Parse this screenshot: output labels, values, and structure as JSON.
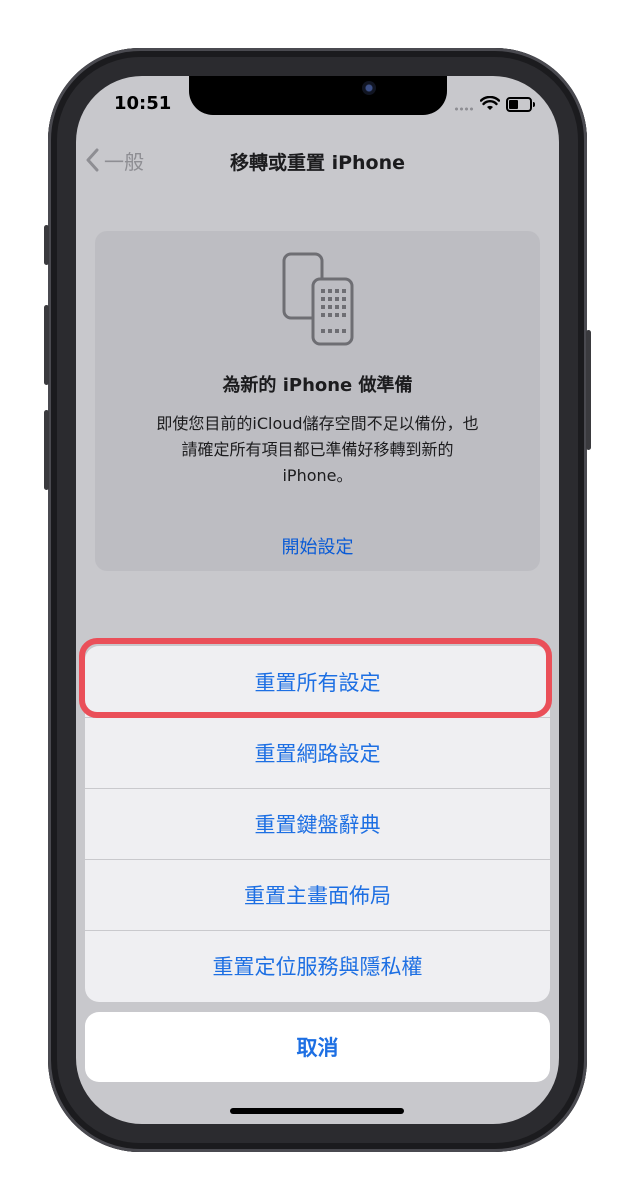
{
  "status_bar": {
    "time": "10:51"
  },
  "nav": {
    "back_label": "一般",
    "title": "移轉或重置 iPhone"
  },
  "card": {
    "icon": "iphone-transfer-icon",
    "title": "為新的 iPhone 做準備",
    "body_lines": [
      "即使您目前的iCloud儲存空間不足以備份，也",
      "請確定所有項目都已準備好移轉到新的",
      "iPhone。"
    ],
    "link": "開始設定"
  },
  "action_sheet": {
    "items": [
      "重置所有設定",
      "重置網路設定",
      "重置鍵盤辭典",
      "重置主畫面佈局",
      "重置定位服務與隱私權"
    ],
    "cancel": "取消"
  },
  "colors": {
    "accent": "#1d6fe3",
    "highlight": "#ea4f59"
  }
}
